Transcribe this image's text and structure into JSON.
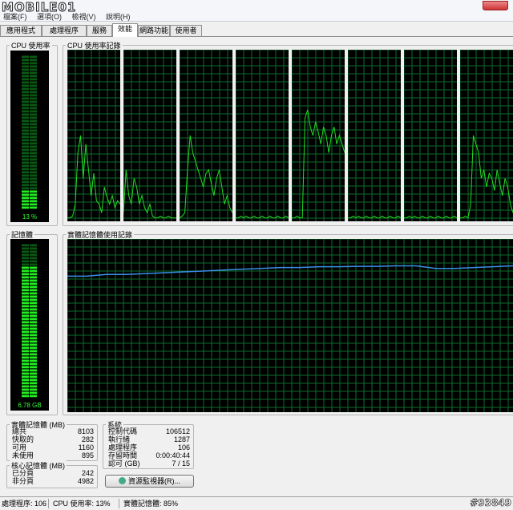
{
  "menubar": {
    "logo_text": "MOBILE01",
    "menu_items": [
      "檔案(F)",
      "選項(O)",
      "檢視(V)",
      "說明(H)"
    ]
  },
  "tabs": [
    "應用程式",
    "處理程序",
    "服務",
    "效能",
    "網路功能",
    "使用者"
  ],
  "active_tab_index": 3,
  "cpu_usage": {
    "title": "CPU 使用率",
    "value_label": "13 %",
    "level": 0.13
  },
  "cpu_history": {
    "title": "CPU 使用率記錄",
    "core_count": 8,
    "line_color": "#22dd22",
    "grid_color": "#0b6b2c"
  },
  "memory": {
    "title": "記憶體",
    "value_label": "6.78 GB",
    "level": 0.85
  },
  "memory_history": {
    "title": "實體記憶體使用記錄",
    "line_color": "#3a8fe6"
  },
  "physical_memory": {
    "title": "實體記憶體 (MB)",
    "rows": [
      {
        "key": "總共",
        "value": "8103"
      },
      {
        "key": "快取的",
        "value": "282"
      },
      {
        "key": "可用",
        "value": "1160"
      },
      {
        "key": "未使用",
        "value": "895"
      }
    ]
  },
  "system": {
    "title": "系統",
    "rows": [
      {
        "key": "控制代碼",
        "value": "106512"
      },
      {
        "key": "執行緒",
        "value": "1287"
      },
      {
        "key": "處理程序",
        "value": "106"
      },
      {
        "key": "存留時間",
        "value": "0:00:40:44"
      },
      {
        "key": "認可 (GB)",
        "value": "7 / 15"
      }
    ]
  },
  "kernel_memory": {
    "title": "核心記憶體 (MB)",
    "rows": [
      {
        "key": "已分頁",
        "value": "242"
      },
      {
        "key": "非分頁",
        "value": "4982"
      }
    ]
  },
  "resource_monitor_button": "資源監視器(R)...",
  "status_bar": {
    "processes": "處理程序: 106",
    "cpu": "CPU 使用率: 13%",
    "memory": "實體記憶體: 85%"
  },
  "watermark": "#93849"
}
